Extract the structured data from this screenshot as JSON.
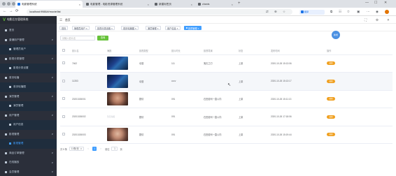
{
  "browser": {
    "tabs": [
      {
        "title": "电影管理系统",
        "active": true
      },
      {
        "title": "电影管理 - 电影资源管理系统",
        "active": false
      },
      {
        "title": "新建标签页",
        "active": false
      },
      {
        "title": "chanis",
        "active": false
      }
    ],
    "url": "localhost:9988/#/movie/list",
    "new_tab": "+",
    "window_controls": [
      "—",
      "☐",
      "✕"
    ],
    "nav": {
      "back": "←",
      "forward": "→",
      "reload": "⟳",
      "home": "⌂"
    },
    "extension_label": "翻译"
  },
  "sidebar": {
    "logo_text": "电影后台管理系统",
    "logo_mark": "V",
    "items": [
      {
        "label": "首页",
        "sub": false,
        "active": false,
        "arrow": ""
      },
      {
        "label": "普通用户管理",
        "sub": false,
        "active": false,
        "arrow": "∨"
      },
      {
        "label": "管理员用户",
        "sub": true,
        "active": false,
        "arrow": ""
      },
      {
        "label": "影视分类管理",
        "sub": false,
        "active": false,
        "arrow": "∨"
      },
      {
        "label": "影视分类设置",
        "sub": true,
        "active": false,
        "arrow": ""
      },
      {
        "label": "首页轮播",
        "sub": false,
        "active": false,
        "arrow": "∨"
      },
      {
        "label": "首页轮播图",
        "sub": true,
        "active": false,
        "arrow": ""
      },
      {
        "label": "演员管理",
        "sub": false,
        "active": false,
        "arrow": "∨"
      },
      {
        "label": "演员管理",
        "sub": true,
        "active": false,
        "arrow": ""
      },
      {
        "label": "用户管理",
        "sub": false,
        "active": false,
        "arrow": "∨"
      },
      {
        "label": "用户信息",
        "sub": true,
        "active": false,
        "arrow": ""
      },
      {
        "label": "影视管理",
        "sub": false,
        "active": false,
        "arrow": "∨"
      },
      {
        "label": "影视管理",
        "sub": true,
        "active": true,
        "arrow": ""
      },
      {
        "label": "商品订单管理",
        "sub": false,
        "active": false,
        "arrow": "∨"
      },
      {
        "label": "在线播放",
        "sub": false,
        "active": false,
        "arrow": "∨"
      },
      {
        "label": "会员管理",
        "sub": false,
        "active": false,
        "arrow": "∨"
      }
    ]
  },
  "header": {
    "title": "首页",
    "right_icons": [
      "⛶",
      "⚙",
      "✕"
    ]
  },
  "tags": [
    {
      "label": "首页",
      "active": false
    },
    {
      "label": "管理员用户 ×",
      "active": false
    },
    {
      "label": "影视分类设置 ×",
      "active": false
    },
    {
      "label": "首页轮播图 ×",
      "active": false
    },
    {
      "label": "演员管理 ×",
      "active": false
    },
    {
      "label": "用户信息 ×",
      "active": false
    },
    {
      "label": "影视管理 ×",
      "active": true
    }
  ],
  "toolbar": {
    "search_placeholder": "请输入影片名",
    "search_button": "查询",
    "fab_label": "新增"
  },
  "table": {
    "columns": [
      "",
      "影片名",
      "海报",
      "影视类型",
      "影片时长",
      "影视导演",
      "状态",
      "发布时间",
      "操作"
    ],
    "rows": [
      {
        "name": "7462",
        "thumb": "game",
        "type": "动漫",
        "duration": "111",
        "director": "鬼灭之刃",
        "status": "上架",
        "date": "2020-10-26 15:13:06",
        "op": "编辑",
        "hover": false
      },
      {
        "name": "11353",
        "thumb": "game",
        "type": "动漫",
        "duration": "ccvv",
        "director": "",
        "status": "上架",
        "date": "2020-10-26 15:13:17",
        "op": "编辑",
        "hover": true
      },
      {
        "name": "20201026001",
        "thumb": "face",
        "type": "剧情",
        "duration": "091",
        "director": "石田健司一直以内",
        "status": "上架",
        "date": "2020-10-26 15:11:13",
        "op": "编辑",
        "hover": false
      },
      {
        "name": "20201026002",
        "thumb": "blank",
        "thumb_text": "暂无海报",
        "type": "剧情",
        "duration": "091",
        "director": "石田健司一直以内",
        "status": "上架",
        "date": "2020-10-26 17:18:06",
        "op": "编辑",
        "hover": false
      },
      {
        "name": "20201026003",
        "thumb": "face2",
        "type": "剧情",
        "duration": "091",
        "director": "石田健司一直以内",
        "status": "上架",
        "date": "2020-10-26 15:19:44",
        "op": "编辑",
        "hover": false
      }
    ]
  },
  "pager": {
    "total": "共 5 条",
    "page_size": "10条/页",
    "page_size_arrow": "∨",
    "prev": "<",
    "current": "1",
    "next": ">",
    "goto": "前往",
    "goto_value": "1",
    "page_suffix": "页"
  },
  "colors": {
    "sidebar_bg": "#2b2f3a",
    "accent": "#409eff",
    "success": "#67c23a",
    "warning": "#f0a020"
  }
}
